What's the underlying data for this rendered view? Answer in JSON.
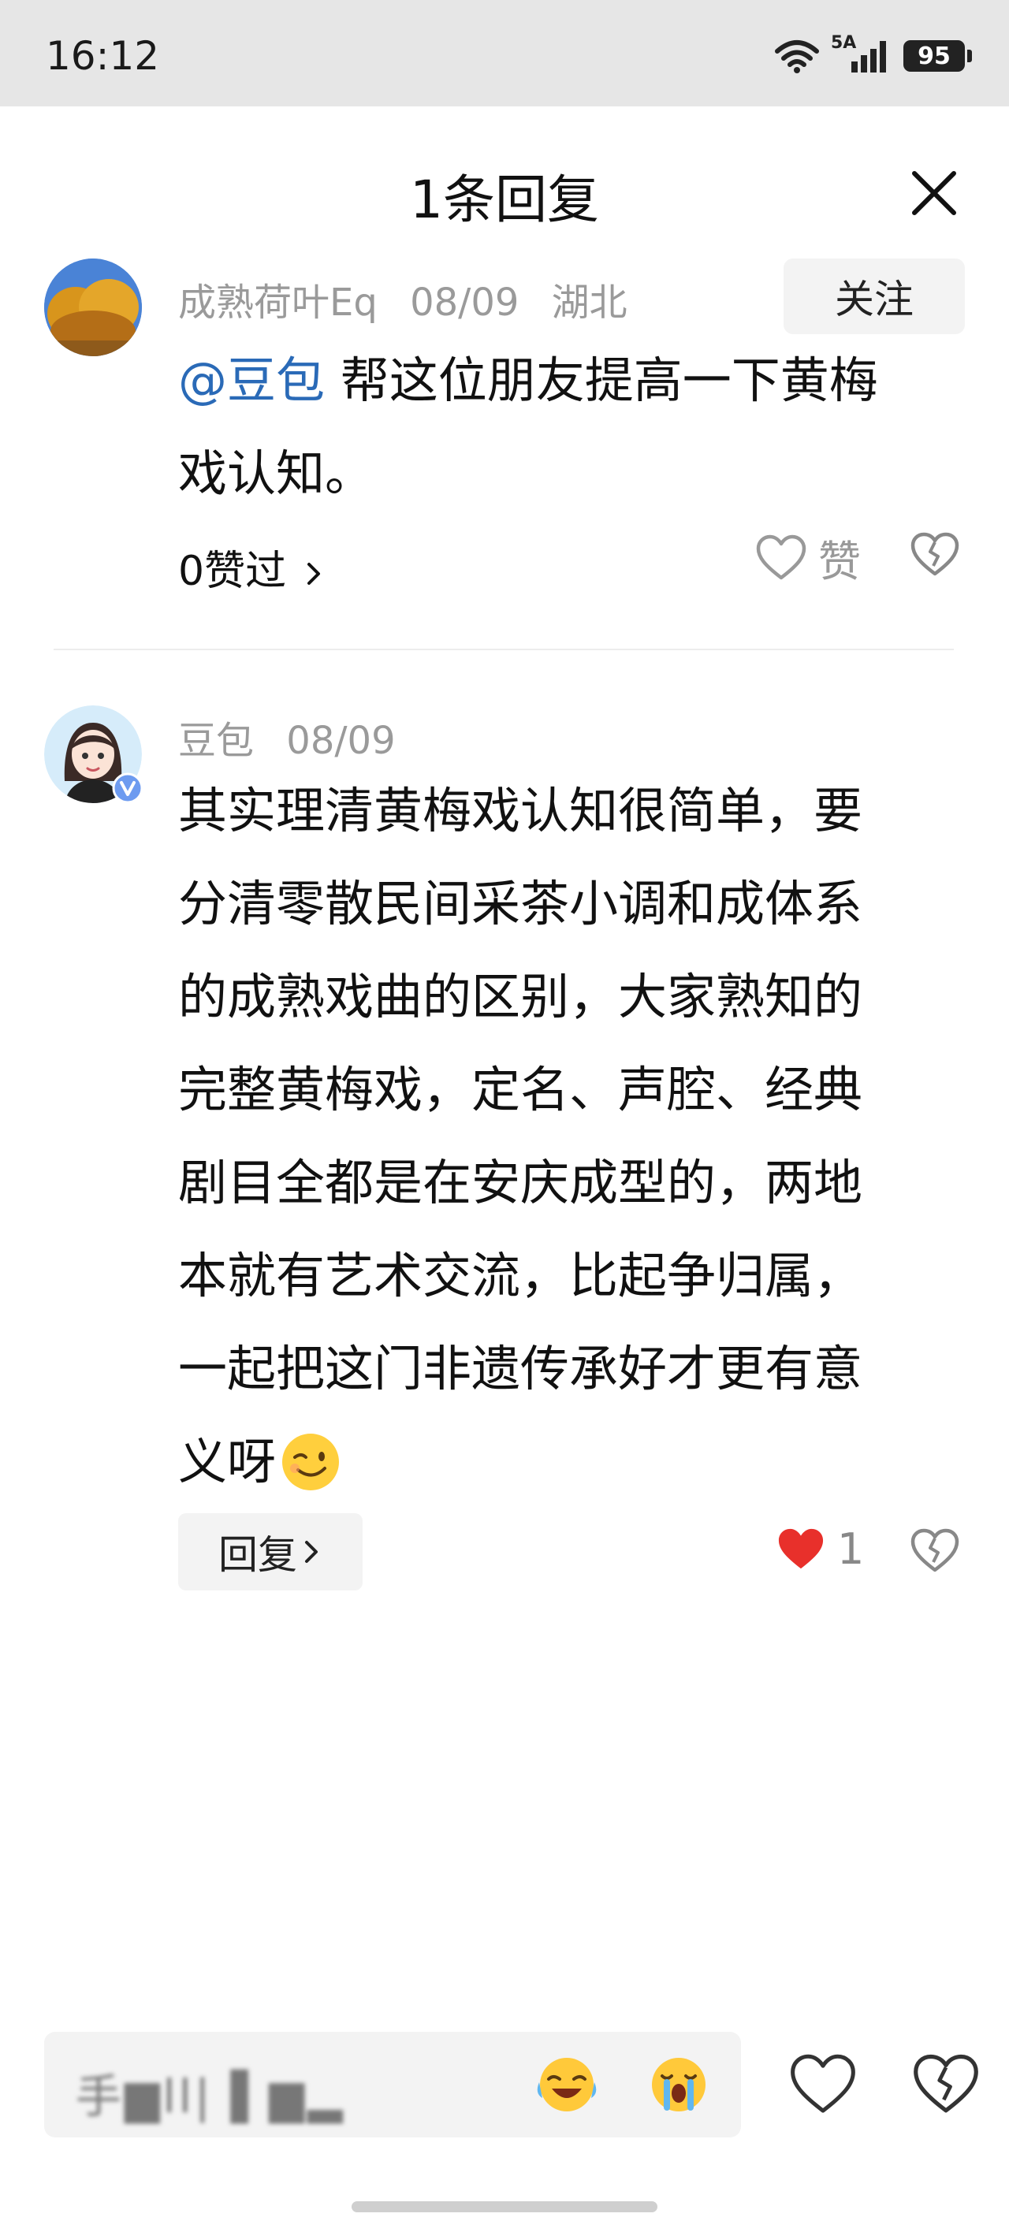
{
  "status_bar": {
    "time": "16:12",
    "network_label": "5A",
    "battery_level": "95"
  },
  "sheet": {
    "title": "1条回复",
    "close_icon": "close-icon"
  },
  "comment": {
    "username": "成熟荷叶Eq",
    "date": "08/09",
    "location": "湖北",
    "follow_label": "关注",
    "mention": "@豆包",
    "text_line1": " 帮这位朋友提高一下黄梅",
    "text_line2": "戏认知。",
    "likes_link": "0赞过",
    "like_label": "赞",
    "avatar_icon": "autumn-tree-avatar"
  },
  "reply": {
    "username": "豆包",
    "date": "08/09",
    "lines": [
      "其实理清黄梅戏认知很简单，要",
      "分清零散民间采茶小调和成体系",
      "的成熟戏曲的区别，大家熟知的",
      "完整黄梅戏，定名、声腔、经典",
      "剧目全都是在安庆成型的，两地",
      "本就有艺术交流，比起争归属，",
      "一起把这门非遗传承好才更有意",
      "义呀"
    ],
    "trailing_emoji": "wink-emoji",
    "reply_button": "回复",
    "like_count": "1",
    "liked": true,
    "avatar_icon": "cartoon-girl-avatar"
  },
  "input_bar": {
    "blurred_text": "手▆ll| ▌▆▂",
    "emojis": [
      "laughing-crying-emoji",
      "sobbing-emoji"
    ]
  },
  "colors": {
    "accent_link": "#2a6ab7",
    "like_red": "#e8302b",
    "status_bar_bg": "#e6e6e6"
  }
}
